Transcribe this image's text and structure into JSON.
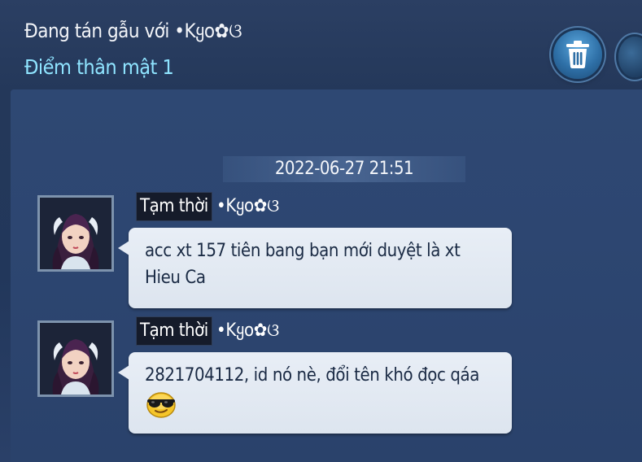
{
  "header": {
    "title": "Đang tán gẫu với •Kყo✿ଓ",
    "intimacy": "Điểm thân mật 1"
  },
  "icons": {
    "trash": "trash-icon",
    "emoji": "sunglasses-emoji-icon"
  },
  "chat": {
    "timestamp": "2022-06-27 21:51",
    "messages": [
      {
        "tag": "Tạm thời",
        "sender": "•Kყo✿ଓ",
        "text": "acc xt 157 tiên bang bạn mới duyệt là xt Hieu Ca"
      },
      {
        "tag": "Tạm thời",
        "sender": "•Kყo✿ଓ",
        "text": "2821704112, id nó nè, đổi tên khó đọc qáa"
      }
    ]
  },
  "colors": {
    "intimacy": "#8fe4ff",
    "bubble": "#e8eef6",
    "background": "#24385a"
  }
}
